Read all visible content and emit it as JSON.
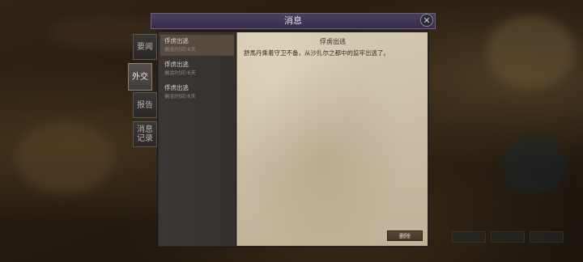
{
  "dialog": {
    "title": "消息",
    "close_icon": "close-icon"
  },
  "tabs": [
    {
      "label": "要闻"
    },
    {
      "label": "外交",
      "active": true
    },
    {
      "label": "报告"
    },
    {
      "label_line1": "消息",
      "label_line2": "记录"
    }
  ],
  "messages": [
    {
      "title": "俘虏出逃",
      "remaining": "剩余时间:6天",
      "selected": true
    },
    {
      "title": "俘虏出逃",
      "remaining": "剩余时间:6天"
    },
    {
      "title": "俘虏出逃",
      "remaining": "剩余时间:6天"
    }
  ],
  "detail": {
    "title": "俘虏出逃",
    "body": "舒馬丹乘着守卫不备，从沙扎尔之都中的监牢出逃了。",
    "delete_label": "删除"
  }
}
